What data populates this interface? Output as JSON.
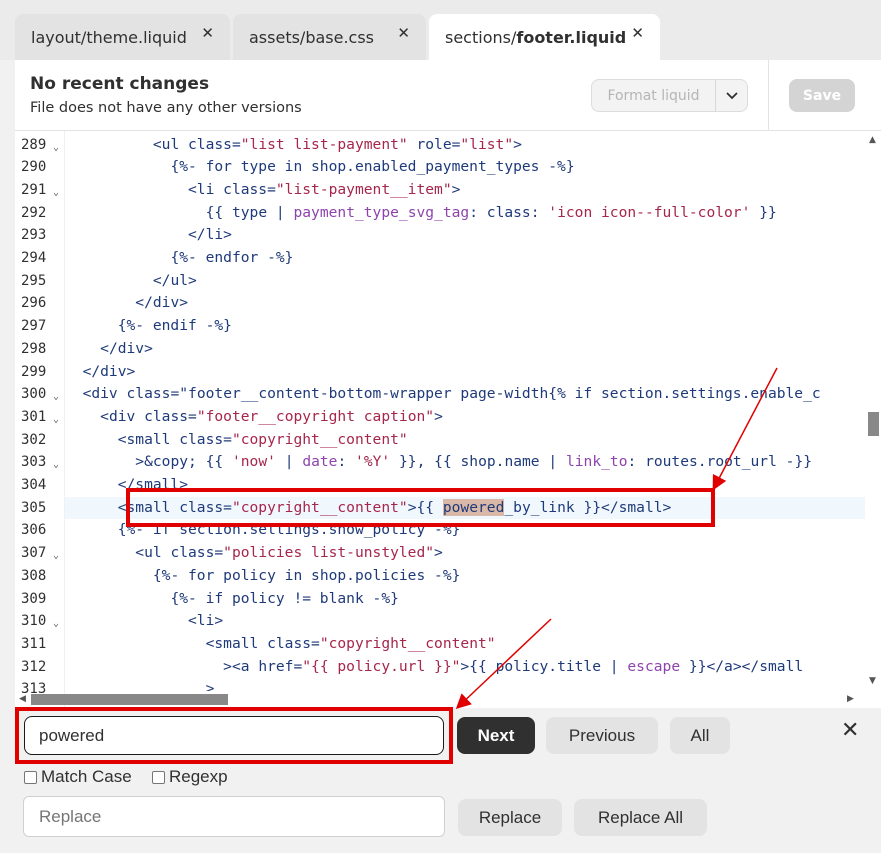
{
  "tabs": [
    {
      "label": "layout/theme.liquid",
      "close": "✕"
    },
    {
      "label": "assets/base.css",
      "close": "✕"
    },
    {
      "label_prefix": "sections/",
      "label_bold": "footer.liquid",
      "close": "✕"
    }
  ],
  "header": {
    "title": "No recent changes",
    "subtitle": "File does not have any other versions",
    "format_label": "Format liquid",
    "save_label": "Save"
  },
  "editor": {
    "line_numbers": [
      "289",
      "290",
      "291",
      "292",
      "293",
      "294",
      "295",
      "296",
      "297",
      "298",
      "299",
      "300",
      "301",
      "302",
      "303",
      "304",
      "305",
      "306",
      "307",
      "308",
      "309",
      "310",
      "311",
      "312",
      "313"
    ],
    "fold_markers": [
      "289",
      "291",
      "300",
      "301",
      "303",
      "307",
      "310"
    ],
    "active_line": "305",
    "lines": [
      "          <ul class=\"list list-payment\" role=\"list\">",
      "            {%- for type in shop.enabled_payment_types -%}",
      "              <li class=\"list-payment__item\">",
      "                {{ type | payment_type_svg_tag: class: 'icon icon--full-color' }}",
      "              </li>",
      "            {%- endfor -%}",
      "          </ul>",
      "        </div>",
      "      {%- endif -%}",
      "    </div>",
      "  </div>",
      "  <div class=\"footer__content-bottom-wrapper page-width{% if section.settings.enable_c",
      "    <div class=\"footer__copyright caption\">",
      "      <small class=\"copyright__content\"",
      "        >&copy; {{ 'now' | date: '%Y' }}, {{ shop.name | link_to: routes.root_url -}}",
      "      </small>",
      "      <small class=\"copyright__content\">{{ powered_by_link }}</small>",
      "      {%- if section.settings.show_policy -%}",
      "        <ul class=\"policies list-unstyled\">",
      "          {%- for policy in shop.policies -%}",
      "            {%- if policy != blank -%}",
      "              <li>",
      "                <small class=\"copyright__content\"",
      "                  ><a href=\"{{ policy.url }}\">{{ policy.title | escape }}</a></small",
      "                >"
    ],
    "match_text": "powered"
  },
  "search": {
    "value": "powered",
    "next_label": "Next",
    "previous_label": "Previous",
    "all_label": "All",
    "close": "✕",
    "match_case_label": "Match Case",
    "regexp_label": "Regexp",
    "replace_placeholder": "Replace",
    "replace_label": "Replace",
    "replace_all_label": "Replace All"
  },
  "colors": {
    "annotation": "#e00000",
    "active_line": "#f1f8fd",
    "next_button": "#303030"
  }
}
